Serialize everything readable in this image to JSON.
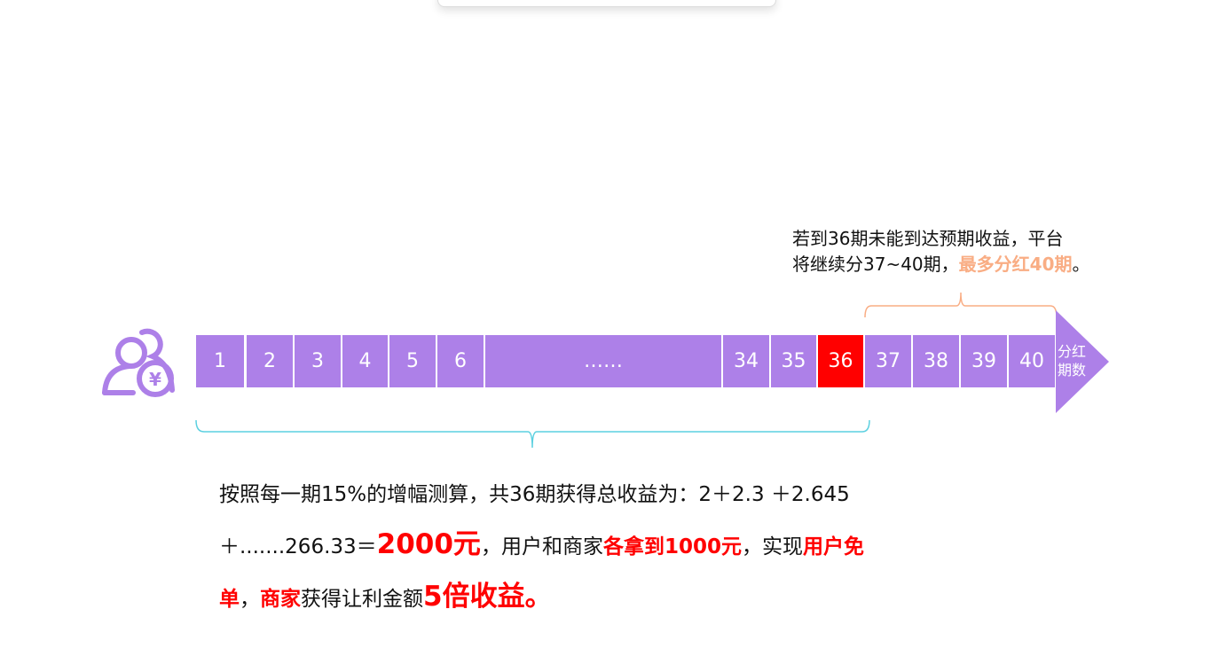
{
  "timeline": {
    "cells": [
      "1",
      "2",
      "3",
      "4",
      "5",
      "6",
      "……",
      "34",
      "35",
      "36",
      "37",
      "38",
      "39",
      "40"
    ],
    "highlight_cell": "36",
    "arrow_label_line1": "分红",
    "arrow_label_line2": "期数",
    "colors": {
      "cell": "#ad80e8",
      "highlight": "#ff0000",
      "bracket_left": "#5bd0e0",
      "bracket_right": "#f9ad84"
    }
  },
  "note": {
    "line1": "若到36期未能到达预期收益，平台",
    "line2_prefix": "将继续分37~40期，",
    "line2_highlight": "最多分红40期",
    "line2_suffix": "。"
  },
  "summary": {
    "p1": "按照每一期15%的增幅测算，共36期获得总收益为：2＋2.3 ＋2.645＋.......266.33＝",
    "p2": "2000元",
    "p3": "，用户和商家",
    "p4": "各拿到1000元",
    "p5": "，实现",
    "p6": "用户免单",
    "p7": "，",
    "p8": "商家",
    "p9": "获得让利金额",
    "p10": "5倍收益。"
  }
}
